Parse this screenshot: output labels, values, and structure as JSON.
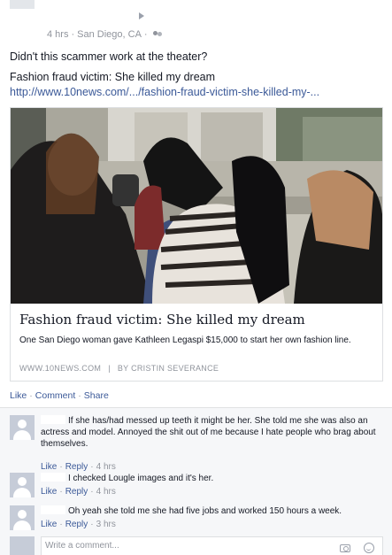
{
  "post": {
    "timestamp": "4 hrs",
    "location": "San Diego, CA",
    "meta_separator": "·",
    "privacy_icon": "friends-icon",
    "status_text": "Didn't this scammer work at the theater?",
    "share_title": "Fashion fraud victim: She killed my dream",
    "share_url": "http://www.10news.com/.../fashion-fraud-victim-she-killed-my-..."
  },
  "link_card": {
    "title": "Fashion fraud victim: She killed my dream",
    "description": "One San Diego woman gave Kathleen Legaspi $15,000 to start her own fashion line.",
    "domain": "WWW.10NEWS.COM",
    "divider": "|",
    "byline": "BY CRISTIN SEVERANCE"
  },
  "actions": {
    "like": "Like",
    "comment": "Comment",
    "share": "Share",
    "dot": "·"
  },
  "comments": [
    {
      "text": "If she has/had messed up teeth it might be her. She told me she was also an actress and model. Annoyed the shit out of me because I hate people who brag about themselves.",
      "like": "Like",
      "reply": "Reply",
      "time": "4 hrs"
    },
    {
      "text": "I checked Lougle images and it's her.",
      "like": "Like",
      "reply": "Reply",
      "time": "4 hrs"
    },
    {
      "text": "Oh yeah she told me she had five jobs and worked 150 hours a week.",
      "like": "Like",
      "reply": "Reply",
      "time": "3 hrs"
    }
  ],
  "composer": {
    "placeholder": "Write a comment..."
  },
  "colors": {
    "link": "#3b5998",
    "muted": "#90949c",
    "comments_bg": "#f6f7f9"
  }
}
